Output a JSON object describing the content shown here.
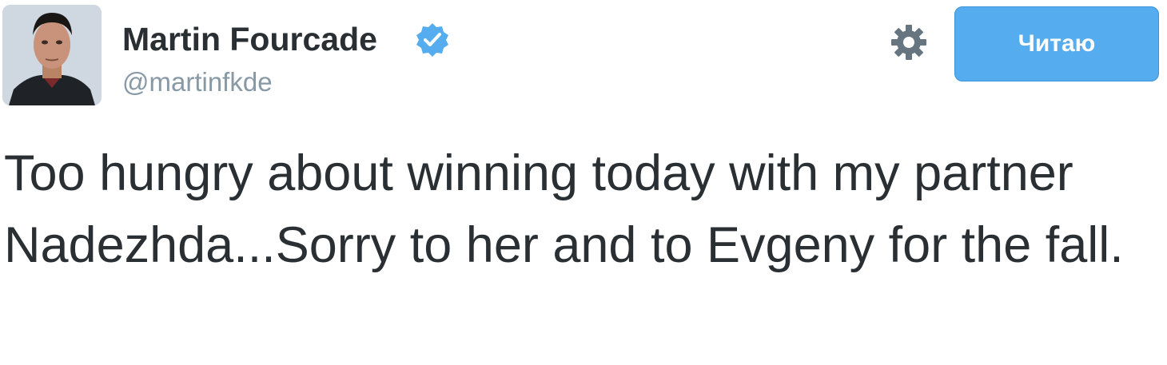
{
  "user": {
    "fullname": "Martin Fourcade",
    "handle": "@martinfkde",
    "verified": true
  },
  "actions": {
    "follow_label": "Читаю",
    "settings_icon": "gear-icon"
  },
  "tweet": {
    "text": "Too hungry about winning today with my partner Nadezhda...Sorry to her and to Evgeny for the fall."
  },
  "colors": {
    "accent": "#55acee",
    "text": "#292f33",
    "muted": "#8899a6",
    "gear": "#66757f"
  }
}
